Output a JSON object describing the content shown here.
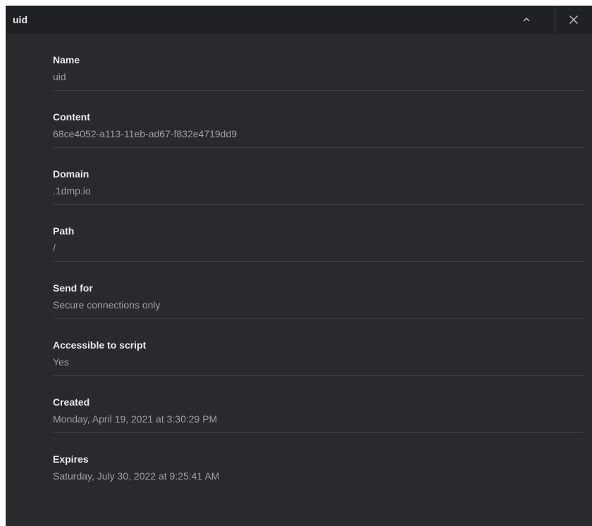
{
  "header": {
    "title": "uid"
  },
  "fields": [
    {
      "label": "Name",
      "value": "uid"
    },
    {
      "label": "Content",
      "value": "68ce4052-a113-11eb-ad67-f832e4719dd9"
    },
    {
      "label": "Domain",
      "value": ".1dmp.io"
    },
    {
      "label": "Path",
      "value": "/"
    },
    {
      "label": "Send for",
      "value": "Secure connections only"
    },
    {
      "label": "Accessible to script",
      "value": "Yes"
    },
    {
      "label": "Created",
      "value": "Monday, April 19, 2021 at 3:30:29 PM"
    },
    {
      "label": "Expires",
      "value": "Saturday, July 30, 2022 at 9:25:41 AM"
    }
  ],
  "icons": {
    "collapse": "chevron-up-icon",
    "close": "close-icon"
  },
  "colors": {
    "panel_background": "#292a2d",
    "header_background": "#202124",
    "label_text": "#e8eaed",
    "value_text": "#9aa0a6",
    "divider": "#3c4043"
  }
}
